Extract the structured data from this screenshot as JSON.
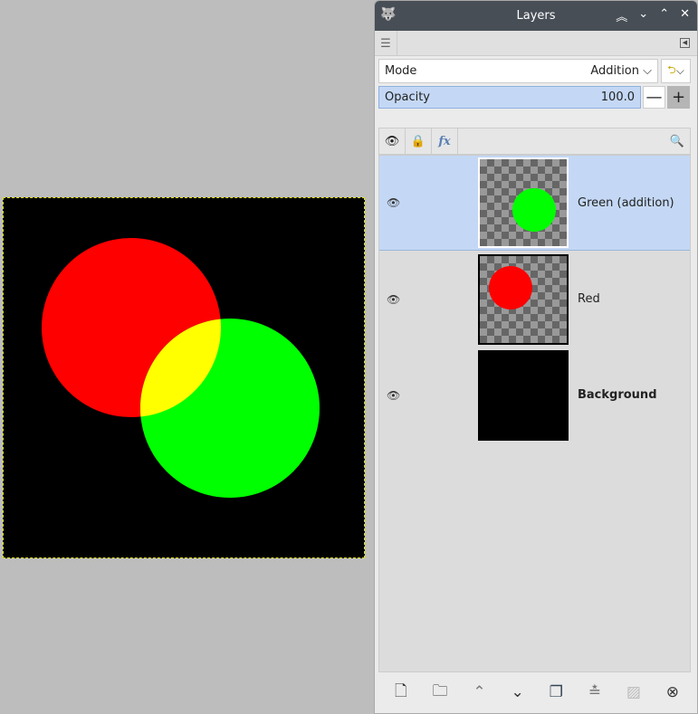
{
  "canvas": {
    "colors": {
      "background": "#000000",
      "red": "#ff0000",
      "green": "#00ff00",
      "overlap": "#ffff00"
    }
  },
  "panel": {
    "title": "Layers",
    "title_controls": [
      "collapse-all",
      "down",
      "up",
      "close"
    ],
    "mode": {
      "label": "Mode",
      "value": "Addition"
    },
    "opacity": {
      "label": "Opacity",
      "value": "100.0"
    },
    "header_icons": [
      "eye-icon",
      "lock-icon",
      "fx-icon",
      "search-icon"
    ],
    "layers": [
      {
        "name": "Green (addition)",
        "selected": true,
        "bold": false
      },
      {
        "name": "Red",
        "selected": false,
        "bold": false
      },
      {
        "name": "Background",
        "selected": false,
        "bold": true
      }
    ],
    "bottom_buttons": [
      "new-layer",
      "new-layer-group",
      "raise-layer",
      "lower-layer",
      "duplicate-layer",
      "merge-down",
      "mask",
      "delete-layer"
    ]
  }
}
